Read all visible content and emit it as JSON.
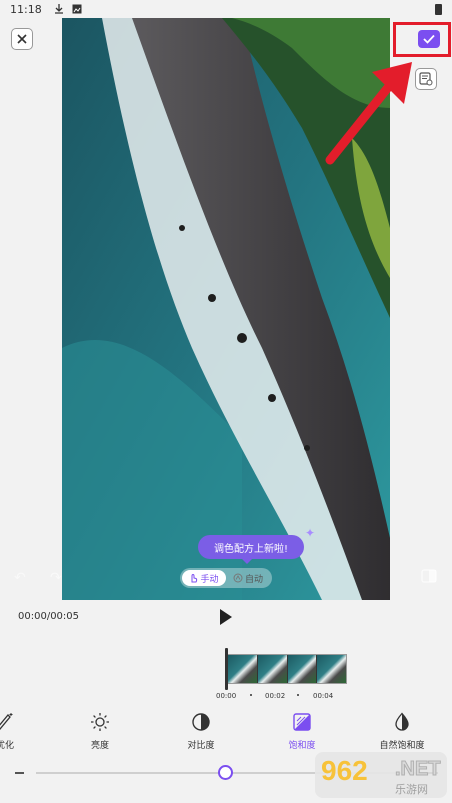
{
  "status_bar": {
    "time": "11:18"
  },
  "editor": {
    "filter_recipe_tooltip": "调色配方上新啦!",
    "mode_toggle": {
      "manual": "手动",
      "auto": "自动"
    },
    "timecode": "00:00/00:05"
  },
  "timeline": {
    "ticks": [
      "00:00",
      "00:02",
      "00:04"
    ]
  },
  "tools": [
    {
      "label": "优化",
      "icon": "auto-enhance-icon"
    },
    {
      "label": "亮度",
      "icon": "brightness-icon"
    },
    {
      "label": "对比度",
      "icon": "contrast-icon"
    },
    {
      "label": "饱和度",
      "icon": "saturation-icon",
      "active": true
    },
    {
      "label": "自然饱和度",
      "icon": "vibrance-icon"
    }
  ],
  "slider": {
    "value": 0.5
  },
  "watermark": {
    "logo": "962",
    "tld": ".NET",
    "site_name": "乐游网"
  },
  "colors": {
    "accent": "#7b4ef0",
    "highlight_outline": "#e31d2b"
  }
}
